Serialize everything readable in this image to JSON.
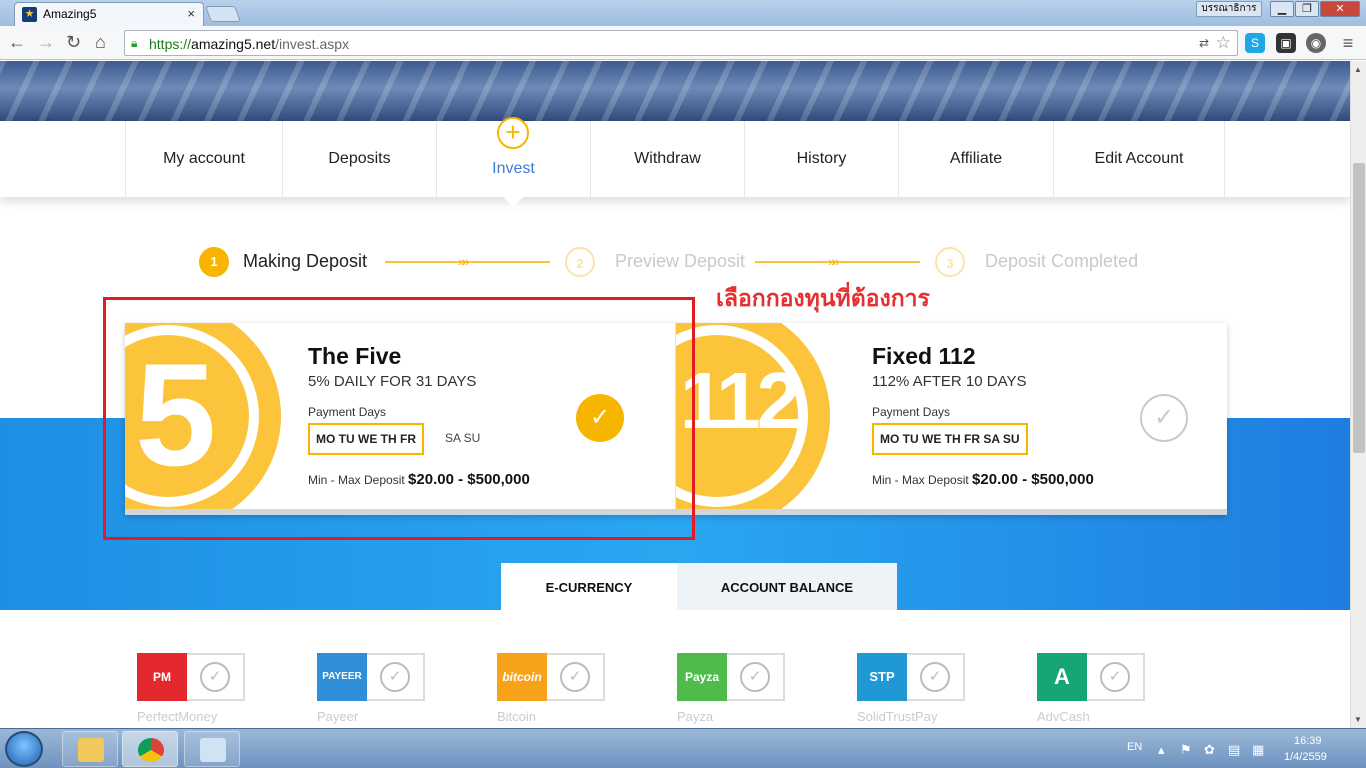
{
  "browser": {
    "tab_title": "Amazing5",
    "tab_close": "×",
    "user_label": "บรรณาธิการ",
    "url_scheme": "https://",
    "url_host": "amazing5.net",
    "url_path": "/invest.aspx"
  },
  "menu": {
    "items": [
      "My account",
      "Deposits",
      "Invest",
      "Withdraw",
      "History",
      "Affiliate",
      "Edit Account"
    ],
    "active": "Invest"
  },
  "steps": [
    {
      "num": "1",
      "label": "Making Deposit",
      "state": "active"
    },
    {
      "num": "2",
      "label": "Preview Deposit",
      "state": "inactive"
    },
    {
      "num": "3",
      "label": "Deposit Completed",
      "state": "inactive"
    }
  ],
  "annotation": "เลือกกองทุนที่ต้องการ",
  "plans": [
    {
      "coin_text": "5",
      "title": "The Five",
      "subtitle": "5% DAILY FOR 31 DAYS",
      "payment_label": "Payment Days",
      "days_active": "MO TU WE TH FR",
      "days_inactive": "SA SU",
      "minmax_label": "Min - Max Deposit",
      "minmax_value": "$20.00 - $500,000",
      "selected": true
    },
    {
      "coin_text": "112",
      "title": "Fixed 112",
      "subtitle": "112% AFTER 10 DAYS",
      "payment_label": "Payment Days",
      "days_active": "MO TU WE TH FR SA SU",
      "days_inactive": "",
      "minmax_label": "Min - Max Deposit",
      "minmax_value": "$20.00 - $500,000",
      "selected": false
    }
  ],
  "deposit_tabs": [
    "E-CURRENCY",
    "ACCOUNT BALANCE"
  ],
  "payment_methods": [
    {
      "name": "PerfectMoney",
      "logo": "PM",
      "color": "#e3292f"
    },
    {
      "name": "Payeer",
      "logo": "PAYEER",
      "color": "#2f8ed8"
    },
    {
      "name": "Bitcoin",
      "logo": "bitcoin",
      "color": "#f7a21a"
    },
    {
      "name": "Payza",
      "logo": "Payza",
      "color": "#4ebb4a"
    },
    {
      "name": "SolidTrustPay",
      "logo": "STP",
      "color": "#1f98d3"
    },
    {
      "name": "AdvCash",
      "logo": "A",
      "color": "#17a673"
    }
  ],
  "taskbar": {
    "lang": "EN",
    "time": "16:39",
    "date": "1/4/2559"
  },
  "colors": {
    "accent": "#f7b500",
    "active_menu": "#3e7ad6",
    "highlight_box": "#e21b23"
  }
}
